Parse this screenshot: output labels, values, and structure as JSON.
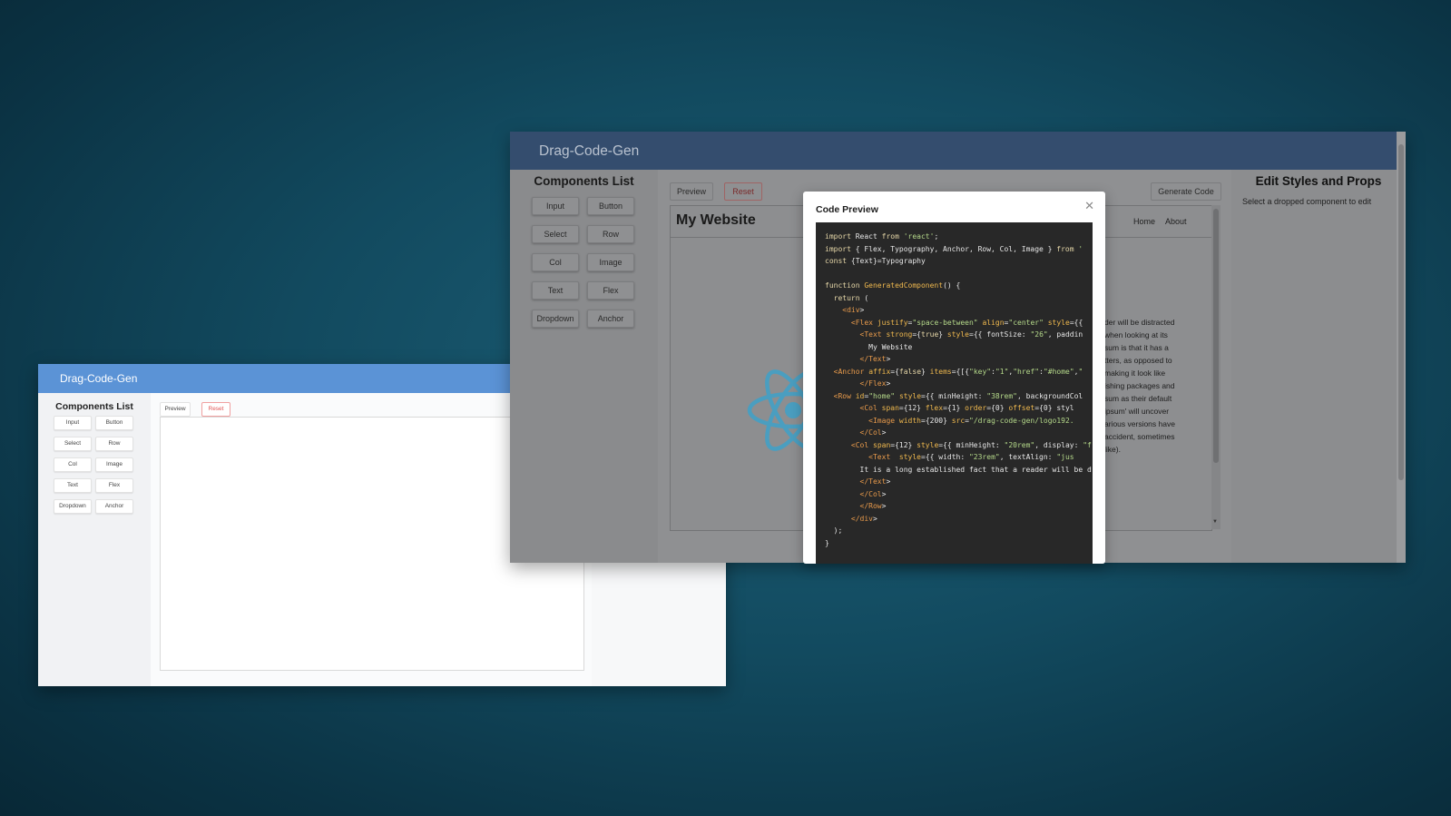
{
  "small_window": {
    "title": "Drag-Code-Gen",
    "components_title": "Components List",
    "components": [
      "Input",
      "Button",
      "Select",
      "Row",
      "Col",
      "Image",
      "Text",
      "Flex",
      "Dropdown",
      "Anchor"
    ],
    "preview_label": "Preview",
    "reset_label": "Reset"
  },
  "main_window": {
    "title": "Drag-Code-Gen",
    "components_title": "Components List",
    "components": [
      "Input",
      "Button",
      "Select",
      "Row",
      "Col",
      "Image",
      "Text",
      "Flex",
      "Dropdown",
      "Anchor"
    ],
    "preview_label": "Preview",
    "reset_label": "Reset",
    "generate_label": "Generate Code",
    "site_title": "My Website",
    "nav_links": [
      "Home",
      "About"
    ],
    "paragraph_lines": [
      "der will be distracted",
      "when looking at its",
      "sum is that it has a",
      "tters, as opposed to",
      "making it look like",
      "ishing packages and",
      "sum as their default",
      "ipsum' will uncover",
      "arious versions have",
      "accident, sometimes",
      "like)."
    ],
    "edit_title": "Edit Styles and Props",
    "edit_subtitle": "Select a dropped component to edit"
  },
  "code_preview": {
    "title": "Code Preview",
    "close_icon": "close-icon",
    "lines": [
      "import React from 'react';",
      "import { Flex, Typography, Anchor, Row, Col, Image } from '",
      "const {Text}=Typography",
      "",
      "function GeneratedComponent() {",
      "  return (",
      "    <div>",
      "      <Flex justify=\"space-between\" align=\"center\" style={{",
      "        <Text strong={true} style={{ fontSize: \"26\", paddin",
      "          My Website",
      "        </Text>",
      "  <Anchor affix={false} items={[{\"key\":\"1\",\"href\":\"#home\",\"",
      "        </Flex>",
      "  <Row id=\"home\" style={{ minHeight: \"38rem\", backgroundCol",
      "        <Col span={12} flex={1} order={0} offset={0} styl",
      "          <Image width={200} src=\"/drag-code-gen/logo192.",
      "        </Col>",
      "      <Col span={12} style={{ minHeight: \"20rem\", display: \"f",
      "          <Text  style={{ width: \"23rem\", textAlign: \"jus",
      "        It is a long established fact that a reader will be d",
      "        </Text>",
      "        </Col>",
      "        </Row>",
      "      </div>",
      "  );",
      "}"
    ]
  },
  "colors": {
    "background": "#124a5f",
    "small_header": "#5b93d6",
    "main_header": "#344d6e",
    "reset_red": "#e05555",
    "react_logo": "#4a9ec0",
    "code_bg": "#282828"
  }
}
